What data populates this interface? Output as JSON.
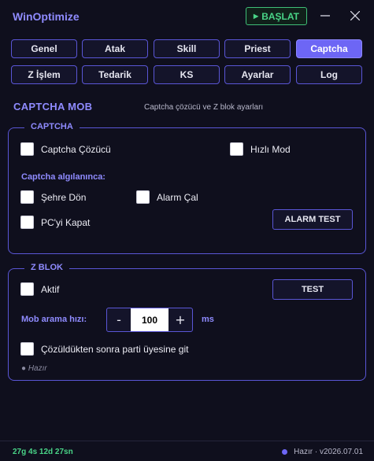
{
  "app": {
    "title": "WinOptimize",
    "start_label": "BAŞLAT",
    "start_icon": "play-icon",
    "minimize_icon": "minimize-icon",
    "close_icon": "close-icon"
  },
  "tabs": [
    {
      "label": "Genel"
    },
    {
      "label": "Atak"
    },
    {
      "label": "Skill"
    },
    {
      "label": "Priest"
    },
    {
      "label": "Captcha",
      "active": true
    },
    {
      "label": "Z İşlem"
    },
    {
      "label": "Tedarik"
    },
    {
      "label": "KS"
    },
    {
      "label": "Ayarlar"
    },
    {
      "label": "Log"
    }
  ],
  "page": {
    "title": "CAPTCHA  MOB",
    "subtitle": "Captcha çözücü ve Z blok ayarları"
  },
  "captcha": {
    "legend": "CAPTCHA",
    "solver_label": "Captcha Çözücü",
    "solver_checked": false,
    "fast_mode_label": "Hızlı Mod",
    "fast_mode_checked": false,
    "on_detect_label": "Captcha algılanınca:",
    "return_town_label": "Şehre Dön",
    "return_town_checked": false,
    "alarm_label": "Alarm Çal",
    "alarm_checked": false,
    "shutdown_pc_label": "PC'yi Kapat",
    "shutdown_pc_checked": false,
    "alarm_test_label": "ALARM TEST"
  },
  "zblok": {
    "legend": "Z BLOK",
    "active_label": "Aktif",
    "active_checked": false,
    "test_label": "TEST",
    "speed_label": "Mob arama hızı:",
    "speed_value": "100",
    "speed_unit": "ms",
    "minus_label": "-",
    "plus_label": "+",
    "party_label": "Çözüldükten sonra parti üyesine git",
    "party_checked": false,
    "status": "● Hazır"
  },
  "statusbar": {
    "uptime": "27g 4s 12d 27sn",
    "status": "Hazır · v2026.07.01",
    "status_color": "#6d66f5"
  }
}
